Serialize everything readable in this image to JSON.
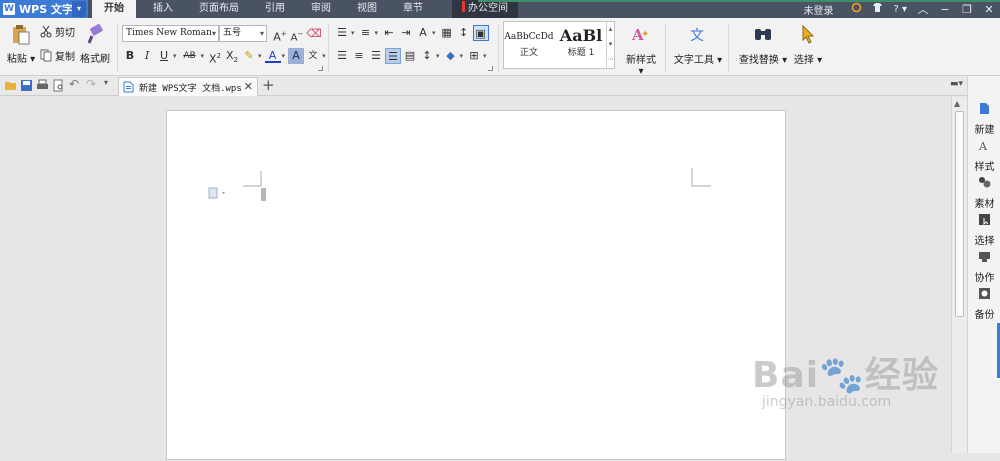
{
  "app": {
    "name": "WPS 文字",
    "logo": "W"
  },
  "menu_tabs": [
    "开始",
    "插入",
    "页面布局",
    "引用",
    "审阅",
    "视图",
    "章节"
  ],
  "office_tab": "办公空间",
  "topright": {
    "login": "未登录"
  },
  "clipboard": {
    "paste": "粘贴",
    "cut": "剪切",
    "copy": "复制",
    "format_painter": "格式刷"
  },
  "font": {
    "family": "Times New Roman",
    "size": "五号"
  },
  "styles": {
    "normal": {
      "preview": "AaBbCcDd",
      "label": "正文"
    },
    "heading1": {
      "preview": "AaBl",
      "label": "标题 1"
    },
    "new_style": "新样式"
  },
  "text_tools": "文字工具",
  "find_replace": "查找替换",
  "select": "选择",
  "document_tab": {
    "title": "新建 WPS文字 文档.wps"
  },
  "task_pane": [
    {
      "label": "新建",
      "icon": "new-doc-icon"
    },
    {
      "label": "样式",
      "icon": "style-icon"
    },
    {
      "label": "素材",
      "icon": "material-icon"
    },
    {
      "label": "选择",
      "icon": "select-icon"
    },
    {
      "label": "协作",
      "icon": "collaborate-icon"
    },
    {
      "label": "备份",
      "icon": "backup-icon"
    }
  ],
  "watermark": {
    "brand": "Bai",
    "brand2": "经验",
    "url": "jingyan.baidu.com"
  },
  "colors": {
    "menubar": "#4a5363",
    "accent": "#3d7bd6",
    "office_mark": "#e53935"
  }
}
